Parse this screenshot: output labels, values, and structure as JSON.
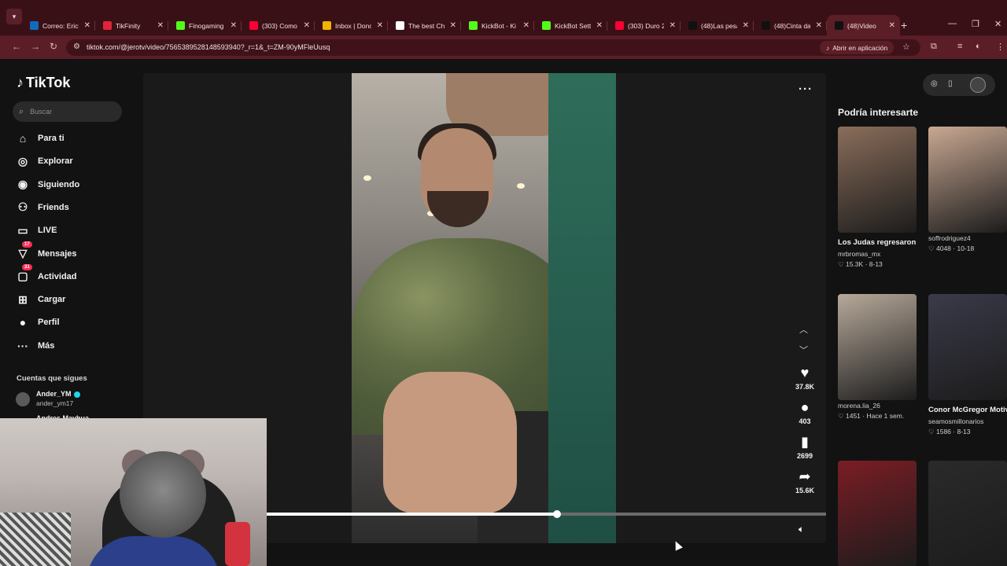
{
  "browser": {
    "tabs": [
      {
        "title": "Correo: Erick",
        "icon": "outlook-icon",
        "color": "#0f6cbd",
        "active": false
      },
      {
        "title": "TikFinity",
        "icon": "tikfinity-icon",
        "color": "#e2233b",
        "active": false
      },
      {
        "title": "Finogaming",
        "icon": "kick-icon",
        "color": "#53fc18",
        "active": false
      },
      {
        "title": "(303) Como",
        "icon": "youtube-icon",
        "color": "#ff0033",
        "active": false
      },
      {
        "title": "Inbox | Dono",
        "icon": "streamlabs-icon",
        "color": "#f0b400",
        "active": false
      },
      {
        "title": "The best Ch",
        "icon": "diamond-icon",
        "color": "#ffffff",
        "active": false
      },
      {
        "title": "KickBot - Ki",
        "icon": "kickbot-icon",
        "color": "#53fc18",
        "active": false
      },
      {
        "title": "KickBot Setti",
        "icon": "kickbot-icon",
        "color": "#53fc18",
        "active": false
      },
      {
        "title": "(303) Duro 2",
        "icon": "youtube-icon",
        "color": "#ff0033",
        "active": false
      },
      {
        "title": "(48)Las pesa",
        "icon": "tiktok-icon",
        "color": "#111111",
        "active": false
      },
      {
        "title": "(48)Cinta da",
        "icon": "tiktok-icon",
        "color": "#111111",
        "active": false
      },
      {
        "title": "(48)Video",
        "icon": "tiktok-icon",
        "color": "#111111",
        "active": true
      }
    ],
    "url": "tiktok.com/@jerotv/video/7565389528148593940?_r=1&_t=ZM-90yMFleUusq",
    "open_in_app": "Abrir en aplicación"
  },
  "sidebar": {
    "logo": "TikTok",
    "search_placeholder": "Buscar",
    "nav": [
      {
        "label": "Para ti",
        "icon": "home-icon",
        "glyph": "⌂",
        "badge": ""
      },
      {
        "label": "Explorar",
        "icon": "compass-icon",
        "glyph": "◎",
        "badge": ""
      },
      {
        "label": "Siguiendo",
        "icon": "following-avatar-icon",
        "glyph": "◉",
        "badge": ""
      },
      {
        "label": "Friends",
        "icon": "friends-icon",
        "glyph": "⚇",
        "badge": ""
      },
      {
        "label": "LIVE",
        "icon": "live-icon",
        "glyph": "▭",
        "badge": ""
      },
      {
        "label": "Mensajes",
        "icon": "messages-icon",
        "glyph": "▽",
        "badge": "17"
      },
      {
        "label": "Actividad",
        "icon": "activity-icon",
        "glyph": "▢",
        "badge": "31"
      },
      {
        "label": "Cargar",
        "icon": "upload-icon",
        "glyph": "⊞",
        "badge": ""
      },
      {
        "label": "Perfil",
        "icon": "profile-icon",
        "glyph": "●",
        "badge": ""
      },
      {
        "label": "Más",
        "icon": "more-icon",
        "glyph": "···",
        "badge": ""
      }
    ],
    "following_heading": "Cuentas que sigues",
    "following": [
      {
        "name": "Ander_YM",
        "handle": "ander_ym17",
        "verified": true
      },
      {
        "name": "Andres Mayhua",
        "handle": "",
        "verified": false
      }
    ]
  },
  "video": {
    "likes": "37.8K",
    "comments": "403",
    "saves": "2699",
    "shares": "15.6K",
    "progress": 0.52
  },
  "recommended": {
    "heading": "Podría interesarte",
    "items": [
      {
        "title": "Los Judas regresaron #elburr...",
        "user": "mrbromas_mx",
        "likes": "15.3K",
        "date": "8-13",
        "thumb": "#8a6d5a"
      },
      {
        "title": "",
        "user": "soffrodriguez4",
        "likes": "4048",
        "date": "10-18",
        "thumb": "#c9a892"
      },
      {
        "title": "",
        "user": "morena.lia_26",
        "likes": "1451",
        "date": "Hace 1 sem.",
        "thumb": "#b7a99a"
      },
      {
        "title": "Conor McGregor Motivación",
        "user": "seamosmillonarios",
        "likes": "1586",
        "date": "8-13",
        "thumb": "#3a3a4a"
      },
      {
        "title": "",
        "user": "",
        "likes": "",
        "date": "",
        "thumb": "#7a1d24"
      },
      {
        "title": "",
        "user": "",
        "likes": "",
        "date": "",
        "thumb": "#2a2a2a"
      }
    ]
  },
  "colors": {
    "accent": "#fe2c55",
    "browser_frame": "#5b1e27"
  }
}
